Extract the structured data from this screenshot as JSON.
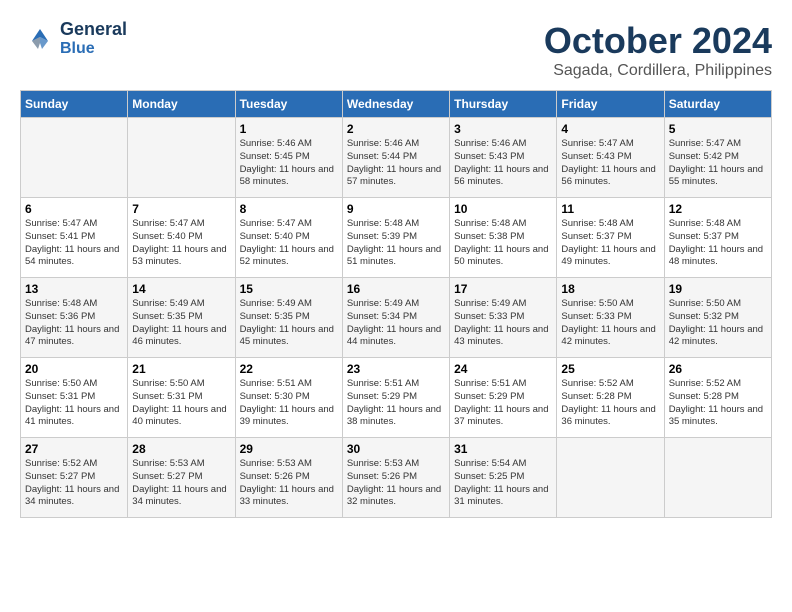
{
  "header": {
    "logo_line1": "General",
    "logo_line2": "Blue",
    "month": "October 2024",
    "location": "Sagada, Cordillera, Philippines"
  },
  "weekdays": [
    "Sunday",
    "Monday",
    "Tuesday",
    "Wednesday",
    "Thursday",
    "Friday",
    "Saturday"
  ],
  "weeks": [
    [
      {
        "day": "",
        "info": ""
      },
      {
        "day": "",
        "info": ""
      },
      {
        "day": "1",
        "info": "Sunrise: 5:46 AM\nSunset: 5:45 PM\nDaylight: 11 hours and 58 minutes."
      },
      {
        "day": "2",
        "info": "Sunrise: 5:46 AM\nSunset: 5:44 PM\nDaylight: 11 hours and 57 minutes."
      },
      {
        "day": "3",
        "info": "Sunrise: 5:46 AM\nSunset: 5:43 PM\nDaylight: 11 hours and 56 minutes."
      },
      {
        "day": "4",
        "info": "Sunrise: 5:47 AM\nSunset: 5:43 PM\nDaylight: 11 hours and 56 minutes."
      },
      {
        "day": "5",
        "info": "Sunrise: 5:47 AM\nSunset: 5:42 PM\nDaylight: 11 hours and 55 minutes."
      }
    ],
    [
      {
        "day": "6",
        "info": "Sunrise: 5:47 AM\nSunset: 5:41 PM\nDaylight: 11 hours and 54 minutes."
      },
      {
        "day": "7",
        "info": "Sunrise: 5:47 AM\nSunset: 5:40 PM\nDaylight: 11 hours and 53 minutes."
      },
      {
        "day": "8",
        "info": "Sunrise: 5:47 AM\nSunset: 5:40 PM\nDaylight: 11 hours and 52 minutes."
      },
      {
        "day": "9",
        "info": "Sunrise: 5:48 AM\nSunset: 5:39 PM\nDaylight: 11 hours and 51 minutes."
      },
      {
        "day": "10",
        "info": "Sunrise: 5:48 AM\nSunset: 5:38 PM\nDaylight: 11 hours and 50 minutes."
      },
      {
        "day": "11",
        "info": "Sunrise: 5:48 AM\nSunset: 5:37 PM\nDaylight: 11 hours and 49 minutes."
      },
      {
        "day": "12",
        "info": "Sunrise: 5:48 AM\nSunset: 5:37 PM\nDaylight: 11 hours and 48 minutes."
      }
    ],
    [
      {
        "day": "13",
        "info": "Sunrise: 5:48 AM\nSunset: 5:36 PM\nDaylight: 11 hours and 47 minutes."
      },
      {
        "day": "14",
        "info": "Sunrise: 5:49 AM\nSunset: 5:35 PM\nDaylight: 11 hours and 46 minutes."
      },
      {
        "day": "15",
        "info": "Sunrise: 5:49 AM\nSunset: 5:35 PM\nDaylight: 11 hours and 45 minutes."
      },
      {
        "day": "16",
        "info": "Sunrise: 5:49 AM\nSunset: 5:34 PM\nDaylight: 11 hours and 44 minutes."
      },
      {
        "day": "17",
        "info": "Sunrise: 5:49 AM\nSunset: 5:33 PM\nDaylight: 11 hours and 43 minutes."
      },
      {
        "day": "18",
        "info": "Sunrise: 5:50 AM\nSunset: 5:33 PM\nDaylight: 11 hours and 42 minutes."
      },
      {
        "day": "19",
        "info": "Sunrise: 5:50 AM\nSunset: 5:32 PM\nDaylight: 11 hours and 42 minutes."
      }
    ],
    [
      {
        "day": "20",
        "info": "Sunrise: 5:50 AM\nSunset: 5:31 PM\nDaylight: 11 hours and 41 minutes."
      },
      {
        "day": "21",
        "info": "Sunrise: 5:50 AM\nSunset: 5:31 PM\nDaylight: 11 hours and 40 minutes."
      },
      {
        "day": "22",
        "info": "Sunrise: 5:51 AM\nSunset: 5:30 PM\nDaylight: 11 hours and 39 minutes."
      },
      {
        "day": "23",
        "info": "Sunrise: 5:51 AM\nSunset: 5:29 PM\nDaylight: 11 hours and 38 minutes."
      },
      {
        "day": "24",
        "info": "Sunrise: 5:51 AM\nSunset: 5:29 PM\nDaylight: 11 hours and 37 minutes."
      },
      {
        "day": "25",
        "info": "Sunrise: 5:52 AM\nSunset: 5:28 PM\nDaylight: 11 hours and 36 minutes."
      },
      {
        "day": "26",
        "info": "Sunrise: 5:52 AM\nSunset: 5:28 PM\nDaylight: 11 hours and 35 minutes."
      }
    ],
    [
      {
        "day": "27",
        "info": "Sunrise: 5:52 AM\nSunset: 5:27 PM\nDaylight: 11 hours and 34 minutes."
      },
      {
        "day": "28",
        "info": "Sunrise: 5:53 AM\nSunset: 5:27 PM\nDaylight: 11 hours and 34 minutes."
      },
      {
        "day": "29",
        "info": "Sunrise: 5:53 AM\nSunset: 5:26 PM\nDaylight: 11 hours and 33 minutes."
      },
      {
        "day": "30",
        "info": "Sunrise: 5:53 AM\nSunset: 5:26 PM\nDaylight: 11 hours and 32 minutes."
      },
      {
        "day": "31",
        "info": "Sunrise: 5:54 AM\nSunset: 5:25 PM\nDaylight: 11 hours and 31 minutes."
      },
      {
        "day": "",
        "info": ""
      },
      {
        "day": "",
        "info": ""
      }
    ]
  ]
}
